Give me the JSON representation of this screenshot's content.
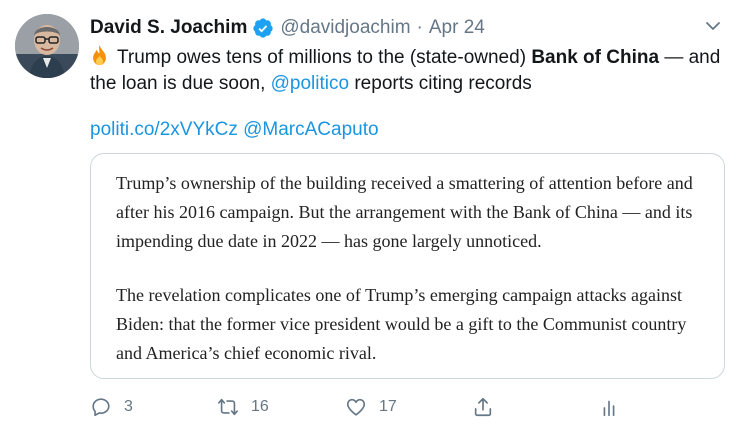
{
  "author": {
    "name": "David S. Joachim",
    "handle": "@davidjoachim",
    "separator": "·",
    "date": "Apr 24"
  },
  "tweet": {
    "emoji": "fire-icon",
    "text_part1": "Trump owes tens of millions to the (state-owned)",
    "bold_text": "Bank of China",
    "text_part2": "— and the loan is due soon,",
    "mention": "@politico",
    "text_part3": "reports citing records",
    "link1": "politi.co/2xVYkCz",
    "link2": "@MarcACaputo"
  },
  "quote": {
    "paragraph1": "Trump’s ownership of the building received a smattering of attention before and after his 2016 campaign. But the arrangement with the Bank of China — and its impending due date in 2022 — has gone largely unnoticed.",
    "paragraph2": "The revelation complicates one of Trump’s emerging campaign attacks against Biden: that the former vice president would be a gift to the Communist country and America’s chief economic rival."
  },
  "actions": {
    "replies": "3",
    "retweets": "16",
    "likes": "17"
  },
  "colors": {
    "link": "#1b95e0",
    "muted": "#657786",
    "verified": "#1da1f2",
    "border": "#ccd6dd"
  }
}
